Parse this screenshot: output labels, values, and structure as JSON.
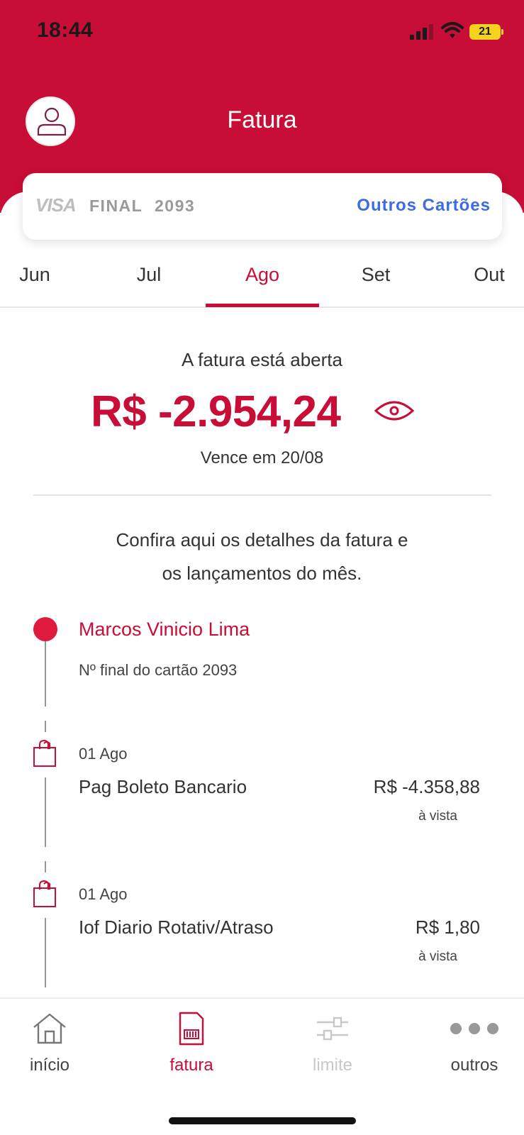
{
  "status_bar": {
    "time": "18:44",
    "battery": "21"
  },
  "header": {
    "title": "Fatura"
  },
  "card": {
    "brand": "VISA",
    "final_label": "FINAL",
    "number": "2093",
    "other_cards": "Outros Cartões"
  },
  "months": [
    "Jun",
    "Jul",
    "Ago",
    "Set",
    "Out"
  ],
  "selected_month": "Ago",
  "invoice": {
    "status": "A fatura está aberta",
    "amount": "R$ -2.954,24",
    "due": "Vence em 20/08",
    "info_line1": "Confira aqui os detalhes da fatura e",
    "info_line2": "os lançamentos do mês."
  },
  "holder": {
    "name": "Marcos Vinicio Lima",
    "card_info": "Nº final do cartão 2093"
  },
  "transactions": [
    {
      "date": "01 Ago",
      "description": "Pag Boleto Bancario",
      "amount": "R$ -4.358,88",
      "type": "à vista"
    },
    {
      "date": "01 Ago",
      "description": "Iof Diario Rotativ/Atraso",
      "amount": "R$ 1,80",
      "type": "à vista"
    }
  ],
  "nav": [
    {
      "label": "início",
      "icon": "home-icon"
    },
    {
      "label": "fatura",
      "icon": "invoice-icon"
    },
    {
      "label": "limite",
      "icon": "sliders-icon"
    },
    {
      "label": "outros",
      "icon": "more-icon"
    }
  ],
  "colors": {
    "primary": "#c80d36",
    "link": "#3d6be8",
    "dot": "#e0193f"
  }
}
